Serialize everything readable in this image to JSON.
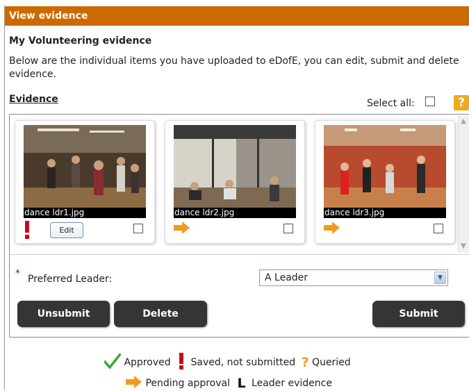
{
  "header": {
    "title": "View evidence"
  },
  "section": {
    "title": "My Volunteering evidence",
    "description": "Below are the individual items you have uploaded to eDofE, you can edit, submit and delete evidence."
  },
  "evidence": {
    "label": "Evidence",
    "select_all_label": "Select all:",
    "help_icon": "?",
    "items": [
      {
        "filename": "dance ldr1.jpg",
        "status": "saved-not-submitted",
        "edit_label": "Edit"
      },
      {
        "filename": "dance ldr2.jpg",
        "status": "pending-approval"
      },
      {
        "filename": "dance ldr3.jpg",
        "status": "pending-approval"
      }
    ]
  },
  "form": {
    "required_marker": "*",
    "preferred_leader_label": "Preferred Leader:",
    "preferred_leader_value": "A Leader"
  },
  "buttons": {
    "unsubmit": "Unsubmit",
    "delete": "Delete",
    "submit": "Submit"
  },
  "legend": {
    "approved": "Approved",
    "saved": "Saved, not submitted",
    "queried": "Queried",
    "pending": "Pending approval",
    "leader_glyph": "L",
    "leader": "Leader evidence"
  },
  "colors": {
    "header": "#cc6a00",
    "pending_arrow": "#f39a1e",
    "saved_mark": "#d0021b",
    "approved_check": "#3aa635"
  }
}
